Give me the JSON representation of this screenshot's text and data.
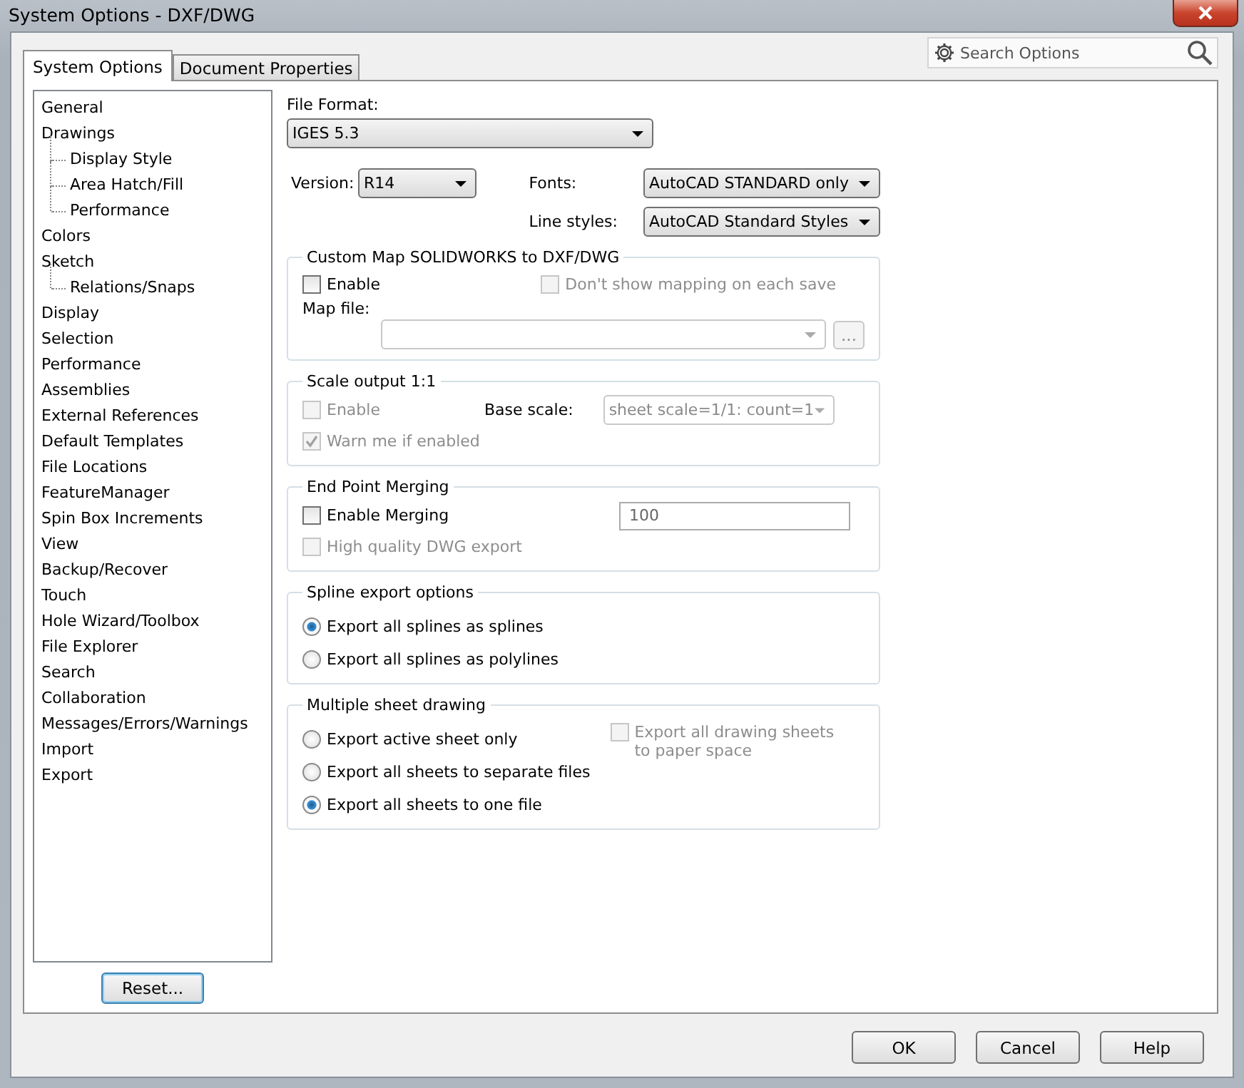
{
  "window": {
    "title": "System Options - DXF/DWG"
  },
  "tabs": [
    {
      "label": "System Options",
      "selected": true
    },
    {
      "label": "Document Properties",
      "selected": false
    }
  ],
  "search": {
    "placeholder": "Search Options"
  },
  "tree": [
    {
      "label": "General"
    },
    {
      "label": "Drawings",
      "children": [
        {
          "label": "Display Style"
        },
        {
          "label": "Area Hatch/Fill"
        },
        {
          "label": "Performance"
        }
      ]
    },
    {
      "label": "Colors"
    },
    {
      "label": "Sketch",
      "children": [
        {
          "label": "Relations/Snaps"
        }
      ]
    },
    {
      "label": "Display"
    },
    {
      "label": "Selection"
    },
    {
      "label": "Performance"
    },
    {
      "label": "Assemblies"
    },
    {
      "label": "External References"
    },
    {
      "label": "Default Templates"
    },
    {
      "label": "File Locations"
    },
    {
      "label": "FeatureManager"
    },
    {
      "label": "Spin Box Increments"
    },
    {
      "label": "View"
    },
    {
      "label": "Backup/Recover"
    },
    {
      "label": "Touch"
    },
    {
      "label": "Hole Wizard/Toolbox"
    },
    {
      "label": "File Explorer"
    },
    {
      "label": "Search"
    },
    {
      "label": "Collaboration"
    },
    {
      "label": "Messages/Errors/Warnings"
    },
    {
      "label": "Import"
    },
    {
      "label": "Export"
    }
  ],
  "reset_button": "Reset...",
  "file_format": {
    "label": "File Format:",
    "value": "IGES 5.3"
  },
  "version": {
    "label": "Version:",
    "value": "R14"
  },
  "fonts": {
    "label": "Fonts:",
    "value": "AutoCAD STANDARD only"
  },
  "line_styles": {
    "label": "Line styles:",
    "value": "AutoCAD Standard Styles"
  },
  "custom_map": {
    "title": "Custom Map SOLIDWORKS to DXF/DWG",
    "enable": {
      "label": "Enable",
      "checked": false,
      "disabled": false
    },
    "dont_show": {
      "label": "Don't show mapping on each save",
      "checked": false,
      "disabled": true
    },
    "map_file_label": "Map file:",
    "browse_button": "..."
  },
  "scale_output": {
    "title": "Scale output 1:1",
    "enable": {
      "label": "Enable",
      "checked": false,
      "disabled": true
    },
    "base_scale": {
      "label": "Base scale:",
      "value": "sheet scale=1/1: count=1"
    },
    "warn": {
      "label": "Warn me if enabled",
      "checked": true,
      "disabled": true
    }
  },
  "end_point": {
    "title": "End Point Merging",
    "enable": {
      "label": "Enable Merging",
      "checked": false,
      "disabled": false
    },
    "value": "100",
    "high_quality": {
      "label": "High quality DWG export",
      "checked": false,
      "disabled": true
    }
  },
  "spline": {
    "title": "Spline export options",
    "options": [
      {
        "label": "Export all splines as splines",
        "selected": true
      },
      {
        "label": "Export all splines as polylines",
        "selected": false
      }
    ]
  },
  "multiple_sheet": {
    "title": "Multiple sheet drawing",
    "options": [
      {
        "label": "Export active sheet only",
        "selected": false
      },
      {
        "label": "Export all sheets to separate files",
        "selected": false
      },
      {
        "label": "Export all sheets to one file",
        "selected": true
      }
    ],
    "paper_space": {
      "label": "Export all drawing sheets to paper space",
      "checked": false,
      "disabled": true
    }
  },
  "buttons": [
    "OK",
    "Cancel",
    "Help"
  ]
}
